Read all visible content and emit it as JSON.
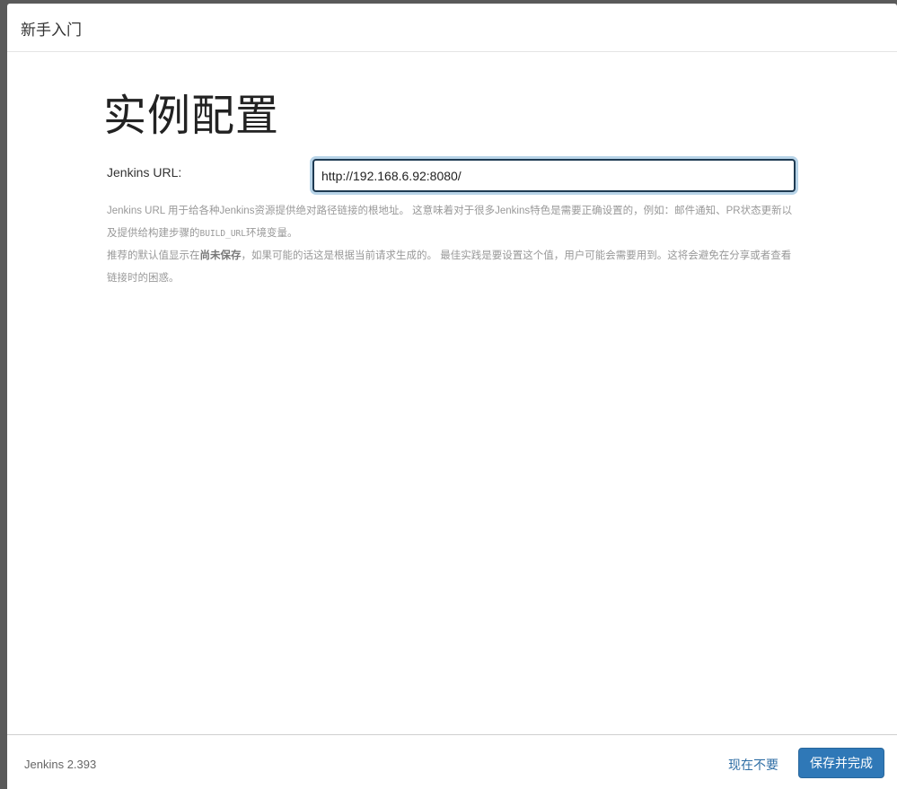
{
  "header": {
    "title": "新手入门"
  },
  "main": {
    "page_title": "实例配置",
    "url_label": "Jenkins URL:",
    "url_value": "http://192.168.6.92:8080/",
    "help": {
      "p1_text1": "Jenkins URL 用于给各种Jenkins资源提供绝对路径链接的根地址。 这意味着对于很多Jenkins特色是需要正确设置的，例如：邮件通知、PR状态更新以及提供给构建步骤的",
      "p1_code": "BUILD_URL",
      "p1_text2": "环境变量。",
      "p2_text1": "推荐的默认值显示在",
      "p2_bold": "尚未保存",
      "p2_text2": "，如果可能的话这是根据当前请求生成的。 最佳实践是要设置这个值，用户可能会需要用到。这将会避免在分享或者查看链接时的困惑。"
    }
  },
  "footer": {
    "version": "Jenkins 2.393",
    "skip_label": "现在不要",
    "save_label": "保存并完成"
  }
}
